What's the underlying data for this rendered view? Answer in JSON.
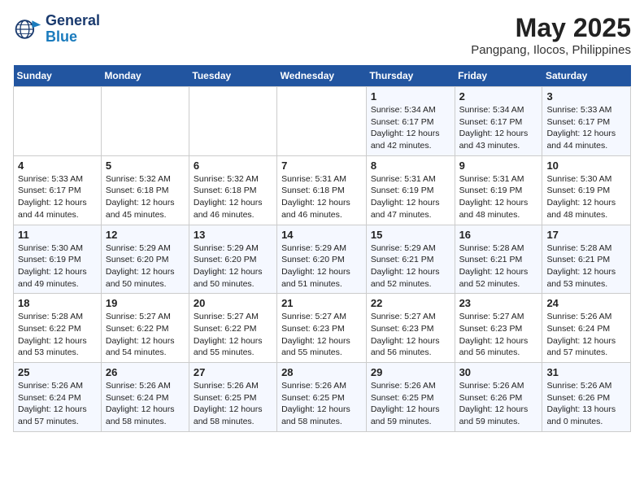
{
  "logo": {
    "line1": "General",
    "line2": "Blue"
  },
  "title": "May 2025",
  "subtitle": "Pangpang, Ilocos, Philippines",
  "days_header": [
    "Sunday",
    "Monday",
    "Tuesday",
    "Wednesday",
    "Thursday",
    "Friday",
    "Saturday"
  ],
  "weeks": [
    [
      {
        "num": "",
        "info": ""
      },
      {
        "num": "",
        "info": ""
      },
      {
        "num": "",
        "info": ""
      },
      {
        "num": "",
        "info": ""
      },
      {
        "num": "1",
        "info": "Sunrise: 5:34 AM\nSunset: 6:17 PM\nDaylight: 12 hours\nand 42 minutes."
      },
      {
        "num": "2",
        "info": "Sunrise: 5:34 AM\nSunset: 6:17 PM\nDaylight: 12 hours\nand 43 minutes."
      },
      {
        "num": "3",
        "info": "Sunrise: 5:33 AM\nSunset: 6:17 PM\nDaylight: 12 hours\nand 44 minutes."
      }
    ],
    [
      {
        "num": "4",
        "info": "Sunrise: 5:33 AM\nSunset: 6:17 PM\nDaylight: 12 hours\nand 44 minutes."
      },
      {
        "num": "5",
        "info": "Sunrise: 5:32 AM\nSunset: 6:18 PM\nDaylight: 12 hours\nand 45 minutes."
      },
      {
        "num": "6",
        "info": "Sunrise: 5:32 AM\nSunset: 6:18 PM\nDaylight: 12 hours\nand 46 minutes."
      },
      {
        "num": "7",
        "info": "Sunrise: 5:31 AM\nSunset: 6:18 PM\nDaylight: 12 hours\nand 46 minutes."
      },
      {
        "num": "8",
        "info": "Sunrise: 5:31 AM\nSunset: 6:19 PM\nDaylight: 12 hours\nand 47 minutes."
      },
      {
        "num": "9",
        "info": "Sunrise: 5:31 AM\nSunset: 6:19 PM\nDaylight: 12 hours\nand 48 minutes."
      },
      {
        "num": "10",
        "info": "Sunrise: 5:30 AM\nSunset: 6:19 PM\nDaylight: 12 hours\nand 48 minutes."
      }
    ],
    [
      {
        "num": "11",
        "info": "Sunrise: 5:30 AM\nSunset: 6:19 PM\nDaylight: 12 hours\nand 49 minutes."
      },
      {
        "num": "12",
        "info": "Sunrise: 5:29 AM\nSunset: 6:20 PM\nDaylight: 12 hours\nand 50 minutes."
      },
      {
        "num": "13",
        "info": "Sunrise: 5:29 AM\nSunset: 6:20 PM\nDaylight: 12 hours\nand 50 minutes."
      },
      {
        "num": "14",
        "info": "Sunrise: 5:29 AM\nSunset: 6:20 PM\nDaylight: 12 hours\nand 51 minutes."
      },
      {
        "num": "15",
        "info": "Sunrise: 5:29 AM\nSunset: 6:21 PM\nDaylight: 12 hours\nand 52 minutes."
      },
      {
        "num": "16",
        "info": "Sunrise: 5:28 AM\nSunset: 6:21 PM\nDaylight: 12 hours\nand 52 minutes."
      },
      {
        "num": "17",
        "info": "Sunrise: 5:28 AM\nSunset: 6:21 PM\nDaylight: 12 hours\nand 53 minutes."
      }
    ],
    [
      {
        "num": "18",
        "info": "Sunrise: 5:28 AM\nSunset: 6:22 PM\nDaylight: 12 hours\nand 53 minutes."
      },
      {
        "num": "19",
        "info": "Sunrise: 5:27 AM\nSunset: 6:22 PM\nDaylight: 12 hours\nand 54 minutes."
      },
      {
        "num": "20",
        "info": "Sunrise: 5:27 AM\nSunset: 6:22 PM\nDaylight: 12 hours\nand 55 minutes."
      },
      {
        "num": "21",
        "info": "Sunrise: 5:27 AM\nSunset: 6:23 PM\nDaylight: 12 hours\nand 55 minutes."
      },
      {
        "num": "22",
        "info": "Sunrise: 5:27 AM\nSunset: 6:23 PM\nDaylight: 12 hours\nand 56 minutes."
      },
      {
        "num": "23",
        "info": "Sunrise: 5:27 AM\nSunset: 6:23 PM\nDaylight: 12 hours\nand 56 minutes."
      },
      {
        "num": "24",
        "info": "Sunrise: 5:26 AM\nSunset: 6:24 PM\nDaylight: 12 hours\nand 57 minutes."
      }
    ],
    [
      {
        "num": "25",
        "info": "Sunrise: 5:26 AM\nSunset: 6:24 PM\nDaylight: 12 hours\nand 57 minutes."
      },
      {
        "num": "26",
        "info": "Sunrise: 5:26 AM\nSunset: 6:24 PM\nDaylight: 12 hours\nand 58 minutes."
      },
      {
        "num": "27",
        "info": "Sunrise: 5:26 AM\nSunset: 6:25 PM\nDaylight: 12 hours\nand 58 minutes."
      },
      {
        "num": "28",
        "info": "Sunrise: 5:26 AM\nSunset: 6:25 PM\nDaylight: 12 hours\nand 58 minutes."
      },
      {
        "num": "29",
        "info": "Sunrise: 5:26 AM\nSunset: 6:25 PM\nDaylight: 12 hours\nand 59 minutes."
      },
      {
        "num": "30",
        "info": "Sunrise: 5:26 AM\nSunset: 6:26 PM\nDaylight: 12 hours\nand 59 minutes."
      },
      {
        "num": "31",
        "info": "Sunrise: 5:26 AM\nSunset: 6:26 PM\nDaylight: 13 hours\nand 0 minutes."
      }
    ]
  ]
}
